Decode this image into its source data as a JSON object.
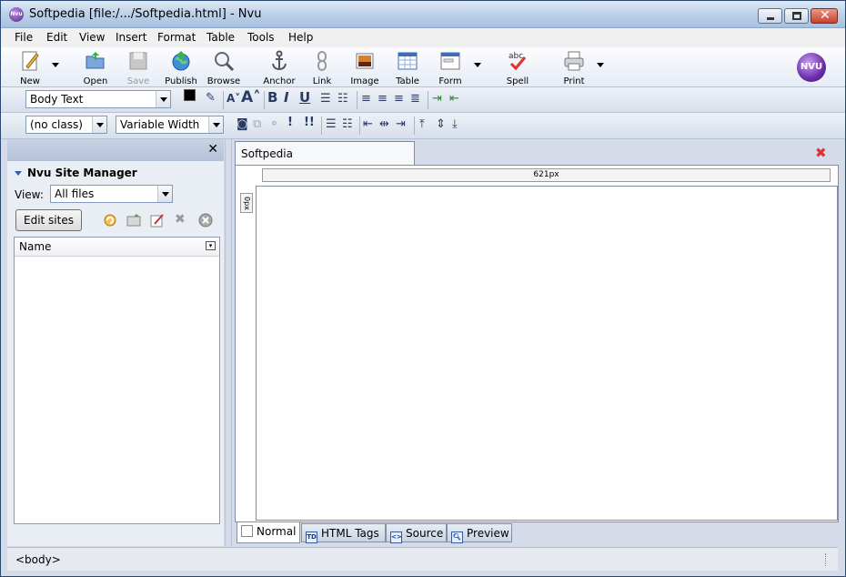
{
  "window": {
    "title": "Softpedia [file:/.../Softpedia.html] - Nvu",
    "app_icon_text": "Nvu"
  },
  "menubar": {
    "items": [
      "File",
      "Edit",
      "View",
      "Insert",
      "Format",
      "Table",
      "Tools",
      "Help"
    ]
  },
  "toolbar": {
    "new": "New",
    "open": "Open",
    "save": "Save",
    "publish": "Publish",
    "browse": "Browse",
    "anchor": "Anchor",
    "link": "Link",
    "image": "Image",
    "table": "Table",
    "form": "Form",
    "spell": "Spell",
    "print": "Print",
    "logo_text": "NVU"
  },
  "format_toolbar": {
    "paragraph_style": "Body Text",
    "class_select": "(no class)",
    "width_select": "Variable Width",
    "text_color": "#000000",
    "bg_color": "#ffffff"
  },
  "site_manager": {
    "title": "Nvu Site Manager",
    "view_label": "View:",
    "view_select": "All files",
    "edit_sites_label": "Edit sites",
    "tree_header": "Name"
  },
  "editor": {
    "tab_title": "Softpedia",
    "hruler_label": "621px",
    "vruler_label": "0px",
    "mode_tabs": [
      "Normal",
      "HTML Tags",
      "Source",
      "Preview"
    ],
    "active_mode": "Normal"
  },
  "statusbar": {
    "path": "<body>"
  }
}
